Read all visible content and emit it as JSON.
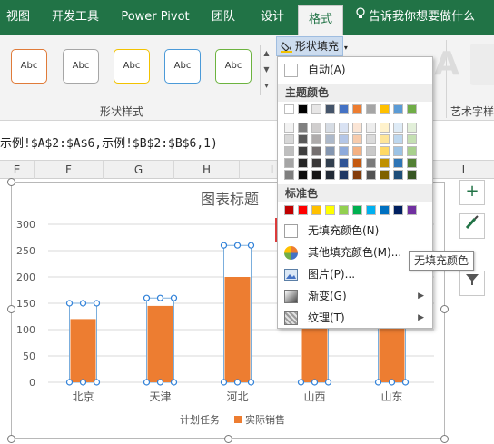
{
  "ribbon_tabs": {
    "view": "视图",
    "developer": "开发工具",
    "powerpivot": "Power Pivot",
    "team": "团队",
    "design": "设计",
    "format": "格式",
    "tell_me": "告诉我你想要做什么"
  },
  "ribbon": {
    "style_button_label": "Abc",
    "style_buttons": [
      {
        "color": "#e07b39"
      },
      {
        "color": "#a6a6a6"
      },
      {
        "color": "#f2c200"
      },
      {
        "color": "#4b9ad8"
      },
      {
        "color": "#6cb33f"
      }
    ],
    "shape_styles_group": "形状样式",
    "art_styles_group": "艺术字样",
    "fill_button": "形状填充",
    "art_letter": "A"
  },
  "formula_bar": {
    "text": "示例!$A$2:$A$6,示例!$B$2:$B$6,1)"
  },
  "column_headers": [
    "E",
    "F",
    "G",
    "H",
    "I",
    "L"
  ],
  "fill_menu": {
    "automatic": "自动(A)",
    "theme_colors_header": "主题颜色",
    "standard_colors_header": "标准色",
    "no_fill": "无填充颜色(N)",
    "more_colors": "其他填充颜色(M)...",
    "picture": "图片(P)...",
    "gradient": "渐变(G)",
    "texture": "纹理(T)",
    "theme_colors": [
      [
        "#ffffff",
        "#000000",
        "#e7e6e6",
        "#44546a",
        "#4472c4",
        "#ed7d31",
        "#a5a5a5",
        "#ffc000",
        "#5b9bd5",
        "#70ad47"
      ],
      [
        "#f2f2f2",
        "#808080",
        "#d0cece",
        "#d6dce4",
        "#d9e2f3",
        "#fbe5d5",
        "#ededed",
        "#fff2cc",
        "#deebf6",
        "#e2efd9"
      ],
      [
        "#d8d8d8",
        "#595959",
        "#aeabab",
        "#adb9ca",
        "#b4c6e7",
        "#f7cbac",
        "#dbdbdb",
        "#fee599",
        "#bdd7ee",
        "#c5e0b3"
      ],
      [
        "#bfbfbf",
        "#3f3f3f",
        "#757070",
        "#8496b0",
        "#8eaadb",
        "#f4b183",
        "#c9c9c9",
        "#ffd965",
        "#9cc3e5",
        "#a8d08d"
      ],
      [
        "#a5a5a5",
        "#262626",
        "#3a3838",
        "#323f4f",
        "#2f5496",
        "#c55a11",
        "#7b7b7b",
        "#bf9000",
        "#2e75b5",
        "#538135"
      ],
      [
        "#7f7f7f",
        "#0c0c0c",
        "#171616",
        "#222a35",
        "#1f3864",
        "#833c0b",
        "#525252",
        "#7f6000",
        "#1e4e79",
        "#375623"
      ]
    ],
    "standard_colors": [
      "#c00000",
      "#ff0000",
      "#ffc000",
      "#ffff00",
      "#92d050",
      "#00b050",
      "#00b0f0",
      "#0070c0",
      "#002060",
      "#7030a0"
    ]
  },
  "tooltip": "无填充颜色",
  "chart_data": {
    "type": "bar",
    "title": "图表标题",
    "categories": [
      "北京",
      "天津",
      "河北",
      "山西",
      "山东"
    ],
    "series": [
      {
        "name": "计划任务",
        "values": [
          150,
          160,
          260,
          130,
          135
        ],
        "color": "#ffffff"
      },
      {
        "name": "实际销售",
        "values": [
          120,
          145,
          200,
          115,
          125
        ],
        "color": "#ed7d31"
      }
    ],
    "ylim": [
      0,
      300
    ],
    "yticks": [
      0,
      50,
      100,
      150,
      200,
      250,
      300
    ],
    "grid": true,
    "legend": "bottom"
  }
}
